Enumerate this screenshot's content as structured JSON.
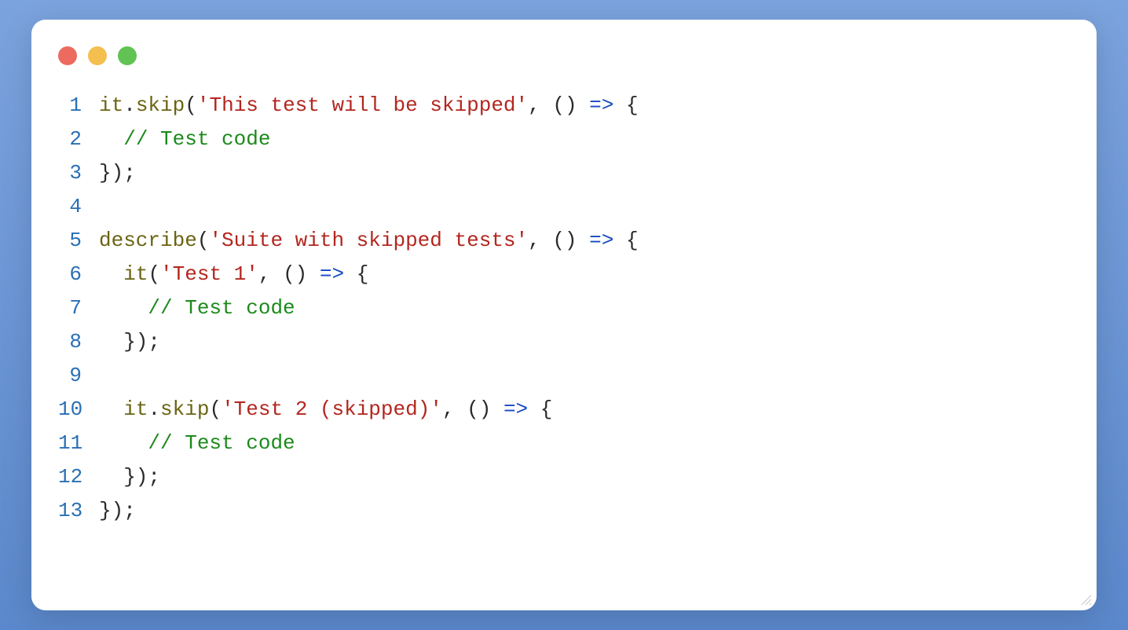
{
  "editor": {
    "traffic": {
      "red": "#ec6a5e",
      "yellow": "#f4bf4f",
      "green": "#61c354"
    },
    "lines": [
      {
        "n": 1,
        "tokens": [
          {
            "c": "tk-fn",
            "t": "it"
          },
          {
            "c": "tk-punct",
            "t": "."
          },
          {
            "c": "tk-fn",
            "t": "skip"
          },
          {
            "c": "tk-punct",
            "t": "("
          },
          {
            "c": "tk-str",
            "t": "'This test will be skipped'"
          },
          {
            "c": "tk-punct",
            "t": ", () "
          },
          {
            "c": "tk-arrow",
            "t": "=>"
          },
          {
            "c": "tk-punct",
            "t": " {"
          }
        ]
      },
      {
        "n": 2,
        "tokens": [
          {
            "c": "tk-punct",
            "t": "  "
          },
          {
            "c": "tk-cmt",
            "t": "// Test code"
          }
        ]
      },
      {
        "n": 3,
        "tokens": [
          {
            "c": "tk-punct",
            "t": "});"
          }
        ]
      },
      {
        "n": 4,
        "tokens": [
          {
            "c": "tk-punct",
            "t": ""
          }
        ]
      },
      {
        "n": 5,
        "tokens": [
          {
            "c": "tk-fn",
            "t": "describe"
          },
          {
            "c": "tk-punct",
            "t": "("
          },
          {
            "c": "tk-str",
            "t": "'Suite with skipped tests'"
          },
          {
            "c": "tk-punct",
            "t": ", () "
          },
          {
            "c": "tk-arrow",
            "t": "=>"
          },
          {
            "c": "tk-punct",
            "t": " {"
          }
        ]
      },
      {
        "n": 6,
        "tokens": [
          {
            "c": "tk-punct",
            "t": "  "
          },
          {
            "c": "tk-fn",
            "t": "it"
          },
          {
            "c": "tk-punct",
            "t": "("
          },
          {
            "c": "tk-str",
            "t": "'Test 1'"
          },
          {
            "c": "tk-punct",
            "t": ", () "
          },
          {
            "c": "tk-arrow",
            "t": "=>"
          },
          {
            "c": "tk-punct",
            "t": " {"
          }
        ]
      },
      {
        "n": 7,
        "tokens": [
          {
            "c": "tk-punct",
            "t": "    "
          },
          {
            "c": "tk-cmt",
            "t": "// Test code"
          }
        ]
      },
      {
        "n": 8,
        "tokens": [
          {
            "c": "tk-punct",
            "t": "  });"
          }
        ]
      },
      {
        "n": 9,
        "tokens": [
          {
            "c": "tk-punct",
            "t": ""
          }
        ]
      },
      {
        "n": 10,
        "tokens": [
          {
            "c": "tk-punct",
            "t": "  "
          },
          {
            "c": "tk-fn",
            "t": "it"
          },
          {
            "c": "tk-punct",
            "t": "."
          },
          {
            "c": "tk-fn",
            "t": "skip"
          },
          {
            "c": "tk-punct",
            "t": "("
          },
          {
            "c": "tk-str",
            "t": "'Test 2 (skipped)'"
          },
          {
            "c": "tk-punct",
            "t": ", () "
          },
          {
            "c": "tk-arrow",
            "t": "=>"
          },
          {
            "c": "tk-punct",
            "t": " {"
          }
        ]
      },
      {
        "n": 11,
        "tokens": [
          {
            "c": "tk-punct",
            "t": "    "
          },
          {
            "c": "tk-cmt",
            "t": "// Test code"
          }
        ]
      },
      {
        "n": 12,
        "tokens": [
          {
            "c": "tk-punct",
            "t": "  });"
          }
        ]
      },
      {
        "n": 13,
        "tokens": [
          {
            "c": "tk-punct",
            "t": "});"
          }
        ]
      }
    ]
  }
}
